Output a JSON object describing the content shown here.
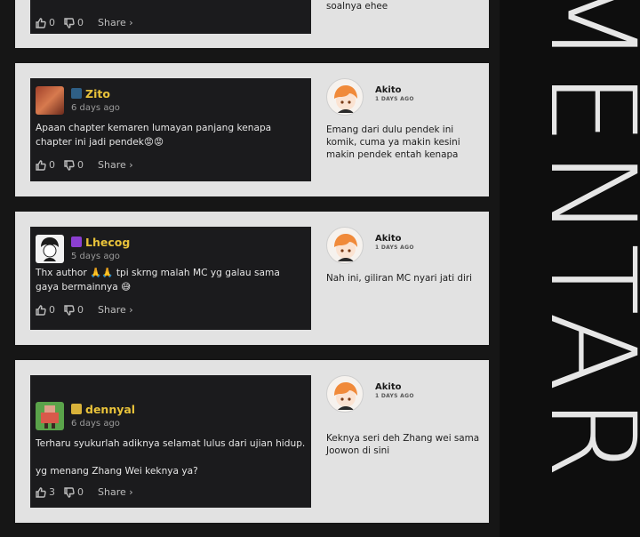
{
  "side_title": "MENTAR",
  "top_card": {
    "actions": {
      "likes": "0",
      "dislikes": "0",
      "share": "Share ›"
    },
    "reply_text": "soalnya ehee"
  },
  "threads": [
    {
      "comment": {
        "username": "Zito",
        "date": "6 days ago",
        "text": "Apaan chapter kemaren lumayan panjang kenapa\nchapter ini jadi pendek😡😡",
        "likes": "0",
        "dislikes": "0",
        "share": "Share ›"
      },
      "reply": {
        "username": "Akito",
        "date": "1 DAYS AGO",
        "text": "Emang dari dulu pendek ini\nkomik, cuma ya makin kesini\nmakin pendek entah kenapa"
      }
    },
    {
      "comment": {
        "username": "Lhecog",
        "date": "5 days ago",
        "text": "Thx author 🙏🙏 tpi skrng malah MC yg galau sama\ngaya bermainnya 😅",
        "likes": "0",
        "dislikes": "0",
        "share": "Share ›"
      },
      "reply": {
        "username": "Akito",
        "date": "1 DAYS AGO",
        "text": "Nah ini, giliran MC nyari jati diri"
      }
    },
    {
      "comment": {
        "username": "dennyal",
        "date": "6 days ago",
        "text": "Terharu syukurlah adiknya selamat lulus dari ujian hidup.\n\nyg menang Zhang Wei keknya ya?",
        "likes": "3",
        "dislikes": "0",
        "share": "Share ›"
      },
      "reply": {
        "username": "Akito",
        "date": "1 DAYS AGO",
        "text": "Keknya seri deh Zhang wei sama\nJoowon di sini"
      }
    }
  ],
  "colors": {
    "username": "#e8c23a",
    "card_bg": "#e2e2e2",
    "comment_bg": "#1b1b1d"
  }
}
